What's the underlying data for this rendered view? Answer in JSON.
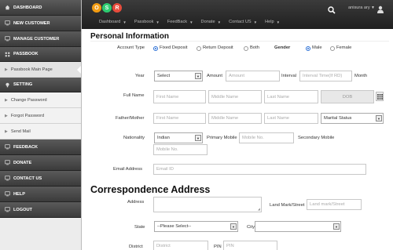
{
  "sidebar": {
    "items": [
      {
        "label": "DASHBOARD",
        "type": "dark",
        "icon": "home-icon"
      },
      {
        "label": "NEW CUSTOMER",
        "type": "dark",
        "icon": "monitor-icon"
      },
      {
        "label": "MANAGE CUSTOMER",
        "type": "dark",
        "icon": "monitor-icon"
      },
      {
        "label": "PASSBOOK",
        "type": "section",
        "icon": "grid-icon"
      },
      {
        "label": "Passbook Main Page",
        "type": "sub"
      },
      {
        "label": "SETTING",
        "type": "section",
        "icon": "bulb-icon"
      },
      {
        "label": "Change Password",
        "type": "sub"
      },
      {
        "label": "Forgot Password",
        "type": "sub"
      },
      {
        "label": "Send Mail",
        "type": "sub"
      },
      {
        "label": "FEEDBACK",
        "type": "dark",
        "icon": "monitor-icon"
      },
      {
        "label": "DONATE",
        "type": "dark",
        "icon": "monitor-icon"
      },
      {
        "label": "CONTACT US",
        "type": "dark",
        "icon": "monitor-icon"
      },
      {
        "label": "HELP",
        "type": "dark",
        "icon": "monitor-icon"
      },
      {
        "label": "LOGOUT",
        "type": "dark",
        "icon": "monitor-icon"
      }
    ]
  },
  "header": {
    "logo_letters": [
      "O",
      "S",
      "R"
    ],
    "logo_colors": [
      "#f39c12",
      "#2ecc71",
      "#e74c3c"
    ],
    "user_name": "anisura ary",
    "topnav": [
      "Dashboard",
      "Passbook",
      "FeedBack",
      "Donate",
      "Contact US",
      "Help"
    ]
  },
  "personal": {
    "title": "Personal Information",
    "account_type_label": "Account Type",
    "account_options": [
      "Fixed Deposit",
      "Return Deposit",
      "Both"
    ],
    "account_selected": 0,
    "gender_label": "Gender",
    "gender_options": [
      "Male",
      "Female"
    ],
    "gender_selected": 0,
    "year_label": "Year",
    "year_value": "Select",
    "amount_label": "Amount",
    "amount_placeholder": "Amount",
    "interval_label": "Interval",
    "interval_placeholder": "Interval Time(If RD)",
    "month_label": "Month",
    "full_name_label": "Full Name",
    "first_name_placeholder": "First Name",
    "middle_name_placeholder": "Middle Name",
    "last_name_placeholder": "Last Name",
    "dob_placeholder": "DOB",
    "father_mother_label": "Father/Mother",
    "marital_status_value": "Marital Status",
    "nationality_label": "Nationality",
    "nationality_value": "Indian",
    "primary_mobile_label": "Primary Mobile",
    "mobile_placeholder": "Mobile No.",
    "secondary_mobile_label": "Secondary Mobile",
    "email_label": "Email Address",
    "email_placeholder": "Email ID"
  },
  "correspondence": {
    "title": "Correspondence Address",
    "address_label": "Address",
    "landmark_label": "Land Mark/Street",
    "landmark_placeholder": "Land mark/Street",
    "state_label": "State",
    "state_value": "--Please Select--",
    "city_label": "City",
    "district_label": "District",
    "district_placeholder": "District",
    "pin_label": "PIN",
    "pin_placeholder": "PIN"
  }
}
